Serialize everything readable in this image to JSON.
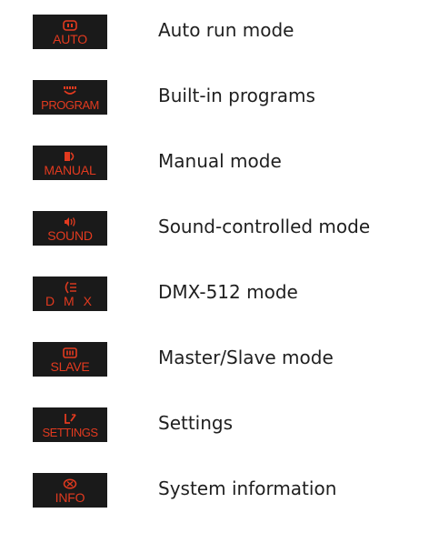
{
  "colors": {
    "badge_background": "#1a1a1a",
    "badge_red": "#e23a1f",
    "text": "#1f1f1f"
  },
  "modes": [
    {
      "badge_label": "AUTO",
      "badge_icon": "auto-icon",
      "description": "Auto run mode"
    },
    {
      "badge_label": "PROGRAM",
      "badge_icon": "program-icon",
      "description": "Built-in programs"
    },
    {
      "badge_label": "MANUAL",
      "badge_icon": "manual-icon",
      "description": "Manual mode"
    },
    {
      "badge_label": "SOUND",
      "badge_icon": "sound-icon",
      "description": "Sound-controlled mode"
    },
    {
      "badge_label": "D M X",
      "badge_icon": "dmx-icon",
      "description": "DMX-512 mode"
    },
    {
      "badge_label": "SLAVE",
      "badge_icon": "slave-icon",
      "description": "Master/Slave mode"
    },
    {
      "badge_label": "SETTINGS",
      "badge_icon": "settings-icon",
      "description": "Settings"
    },
    {
      "badge_label": "INFO",
      "badge_icon": "info-icon",
      "description": "System information"
    }
  ]
}
